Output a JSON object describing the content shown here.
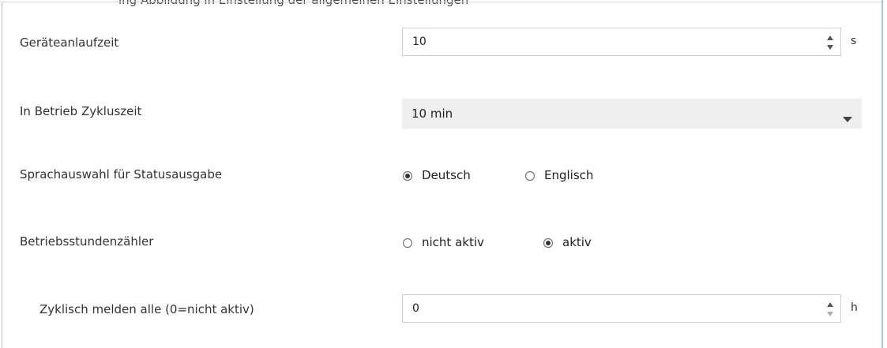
{
  "top_strip_text": "ing Abbildung in Einstellung der allgemeinen Einstellungen",
  "rows": {
    "startup_time": {
      "label": "Geräteanlaufzeit",
      "value": "10",
      "unit": "s"
    },
    "cycle_time": {
      "label": "In Betrieb Zykluszeit",
      "selected": "10 min"
    },
    "language": {
      "label": "Sprachauswahl für Statusausgabe",
      "options": [
        "Deutsch",
        "Englisch"
      ],
      "selected": "Deutsch"
    },
    "hour_counter": {
      "label": "Betriebsstundenzähler",
      "options": [
        "nicht aktiv",
        "aktiv"
      ],
      "selected": "aktiv"
    },
    "report_cyclic": {
      "label": "Zyklisch melden alle (0=nicht aktiv)",
      "value": "0",
      "unit": "h"
    }
  },
  "colors": {
    "input_border": "#cfcfcf",
    "select_bg": "#efefef",
    "frame_accent": "#a7c6e8"
  }
}
